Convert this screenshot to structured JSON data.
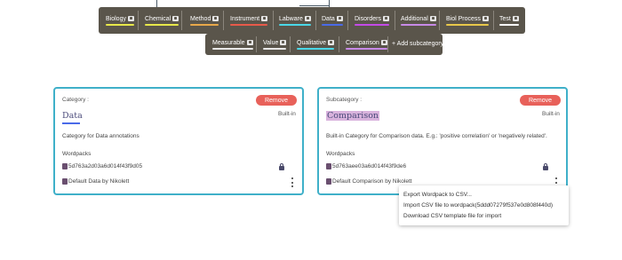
{
  "category_bar": {
    "items": [
      {
        "label": "Biology",
        "color": "#e8e84a"
      },
      {
        "label": "Chemical",
        "color": "#e8e84a"
      },
      {
        "label": "Method",
        "color": "#e8a84a"
      },
      {
        "label": "Instrument",
        "color": "#e85a4a"
      },
      {
        "label": "Labware",
        "color": "#4ad8e8"
      },
      {
        "label": "Data",
        "color": "#4a6ae8"
      },
      {
        "label": "Disorders",
        "color": "#c44ae8"
      },
      {
        "label": "Additional",
        "color": "#c88ae8"
      },
      {
        "label": "Biol Process",
        "color": "#e8c84a"
      },
      {
        "label": "Test",
        "color": "#ffffff"
      }
    ]
  },
  "subcategory_bar": {
    "items": [
      {
        "label": "Measurable",
        "color": "#e8e8e8"
      },
      {
        "label": "Value",
        "color": "#e8e8e8"
      },
      {
        "label": "Qualitative",
        "color": "#4ad8e8"
      },
      {
        "label": "Comparison",
        "color": "#c88ae8"
      }
    ],
    "add_label": "+ Add subcategory"
  },
  "category_card": {
    "label": "Category :",
    "remove": "Remove",
    "name": "Data",
    "builtin": "Built-in",
    "description": "Category for Data annotations",
    "wordpacks_title": "Wordpacks",
    "wordpacks": [
      "5d763a2d03a6d014f43f9d05",
      "Default Data by Nikolett"
    ],
    "underline_color": "#4a6ae8"
  },
  "subcategory_card": {
    "label": "Subcategory :",
    "remove": "Remove",
    "name": "Comparison",
    "builtin": "Built-in",
    "description": "Built-in Category for Comparison data. E.g.: 'positive correlation' or 'negatively related'.",
    "wordpacks_title": "Wordpacks",
    "wordpacks": [
      "5d763aee03a6d014f43f9de6",
      "Default Comparison by Nikolett"
    ],
    "highlight_color": "#d9b3dd"
  },
  "context_menu": {
    "items": [
      "Export Wordpack to CSV...",
      "Import CSV file to wordpack(5ddd07279f537e0d808f440d)",
      "Download CSV template file for import"
    ]
  },
  "colors": {
    "accent": "#3fb0c9",
    "remove": "#e8615a",
    "bar": "#5a554b"
  }
}
